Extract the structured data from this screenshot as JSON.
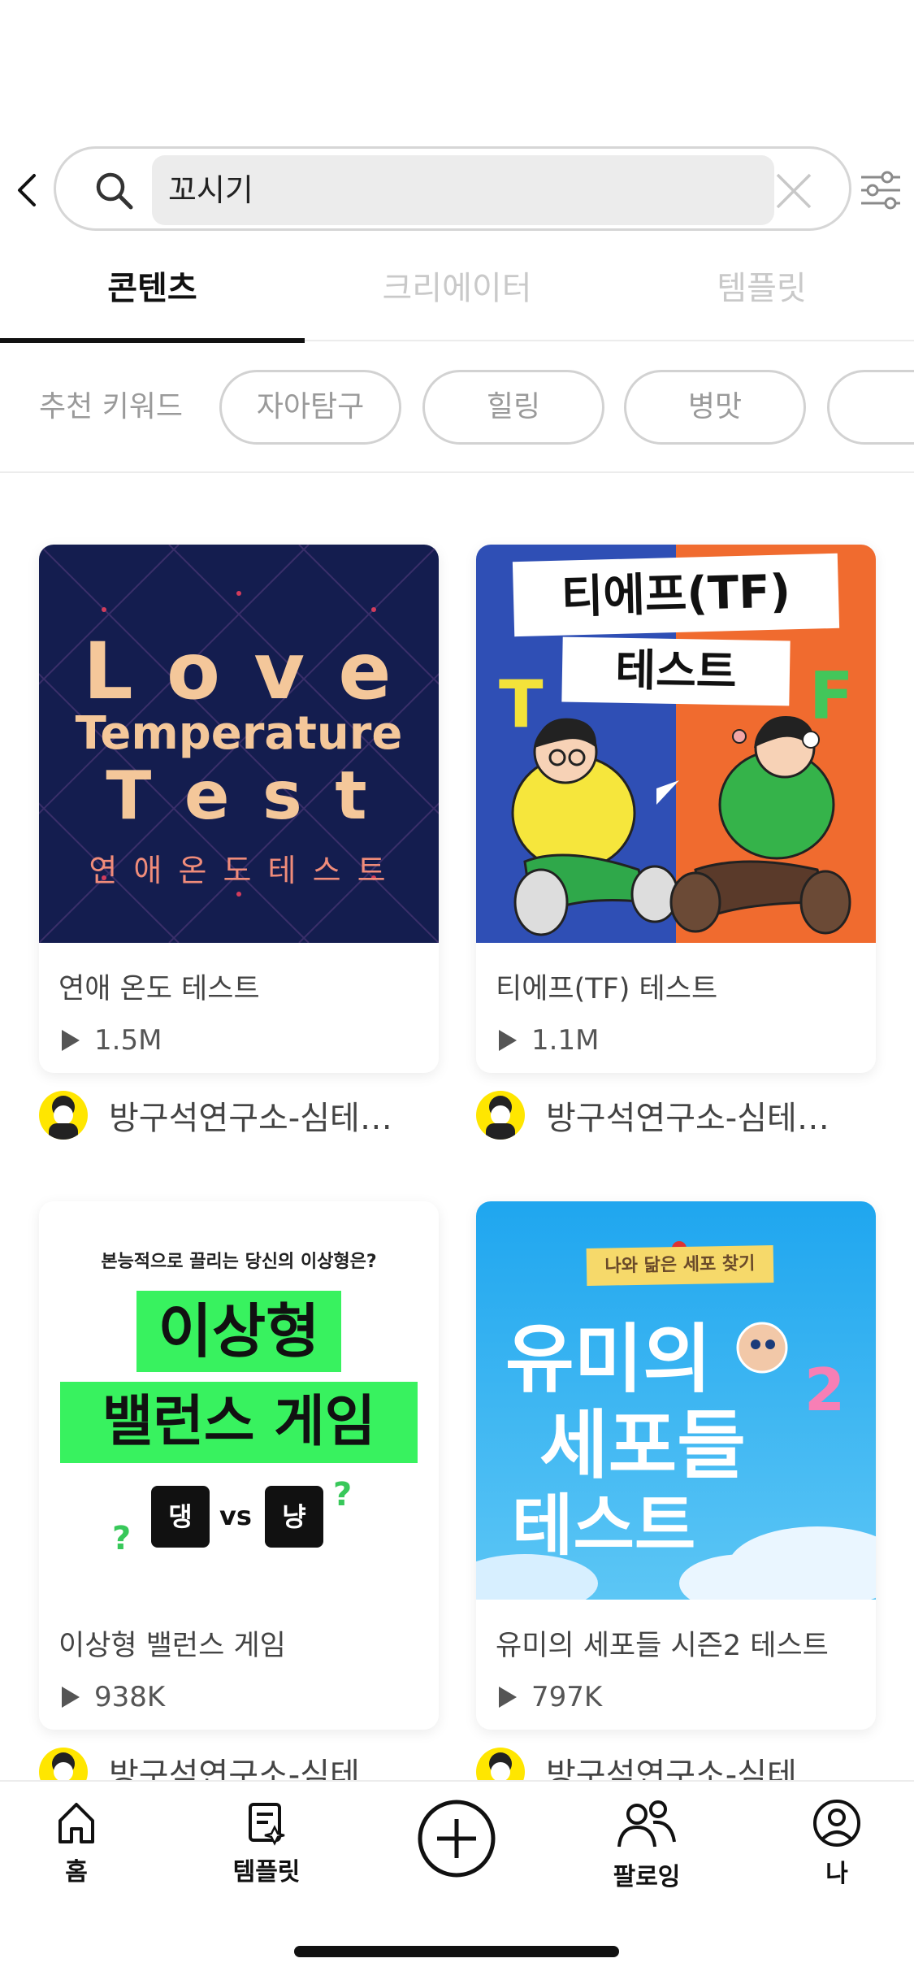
{
  "search": {
    "query": "꼬시기"
  },
  "tabs": [
    {
      "label": "콘텐츠",
      "active": true
    },
    {
      "label": "크리에이터",
      "active": false
    },
    {
      "label": "템플릿",
      "active": false
    }
  ],
  "keywords": {
    "label": "추천 키워드",
    "chips": [
      "자아탐구",
      "힐링",
      "병맛",
      ""
    ]
  },
  "cards": [
    {
      "title": "연애 온도 테스트",
      "plays": "1.5M",
      "creator": "방구석연구소-심테…",
      "thumb": {
        "line1": "L  o  v  e",
        "line2": "Temperature",
        "line3": "T  e  s  t",
        "line4": "연 애  온 도  테 스 트",
        "bg": "#141d4f",
        "text_color": "#f4c79a"
      }
    },
    {
      "title": "티에프(TF) 테스트",
      "plays": "1.1M",
      "creator": "방구석연구소-심테…",
      "thumb": {
        "line1": "티에프(TF)",
        "line2": "테스트",
        "letter_t": "T",
        "letter_f": "F",
        "bg_left": "#2f4fb5",
        "bg_right": "#f06b2f"
      }
    },
    {
      "title": "이상형 밸런스 게임",
      "plays": "938K",
      "creator": "방구석연구소-심테…",
      "thumb": {
        "subtitle": "본능적으로 끌리는 당신의 이상형은?",
        "line1": "이상형",
        "line2": "밸런스 게임",
        "key_left": "댕",
        "vs": "vs",
        "key_right": "냥",
        "q": "?",
        "accent": "#38f25f"
      }
    },
    {
      "title": "유미의 세포들 시즌2 테스트",
      "plays": "797K",
      "creator": "방구석연구소-심테…",
      "thumb": {
        "banner": "나와 닮은 세포 찾기",
        "line1": "유미의",
        "line2": "세포들",
        "line3": "테스트",
        "num": "2",
        "bg": "#2fb3f0"
      }
    }
  ],
  "nav": {
    "home": "홈",
    "templates": "템플릿",
    "following": "팔로잉",
    "me": "나"
  },
  "icons": {
    "back": "chevron-left-icon",
    "search": "search-icon",
    "clear": "close-icon",
    "filter": "sliders-icon",
    "play": "play-icon",
    "home": "home-icon",
    "templates": "template-icon",
    "create": "plus-circle-icon",
    "following": "users-icon",
    "me": "user-circle-icon"
  }
}
